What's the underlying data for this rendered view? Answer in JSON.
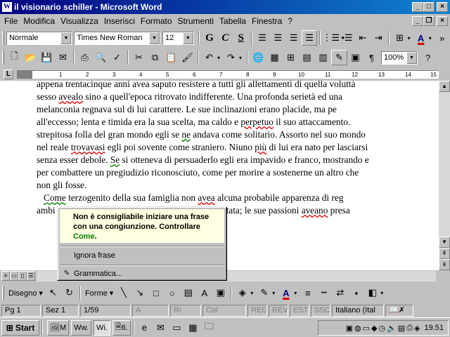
{
  "window": {
    "title": "il visionario schiller - Microsoft Word",
    "app_icon_text": "W",
    "controls": {
      "minimize": "_",
      "maximize": "□",
      "close": "×"
    }
  },
  "menubar": {
    "items": [
      "File",
      "Modifica",
      "Visualizza",
      "Inserisci",
      "Formato",
      "Strumenti",
      "Tabella",
      "Finestra",
      "?"
    ],
    "doc_controls": {
      "minimize": "_",
      "restore": "❐",
      "close": "×"
    }
  },
  "formatting": {
    "style": "Normale",
    "font": "Times New Roman",
    "size": "12",
    "bold": "G",
    "italic": "C",
    "underline": "S",
    "border_dropdown": "▾",
    "font_color_letter": "A"
  },
  "standard": {
    "zoom": "100%"
  },
  "ruler": {
    "tab_selector": "L",
    "ticks": [
      "1",
      "2",
      "3",
      "4",
      "5",
      "6",
      "7",
      "8",
      "9",
      "10",
      "11",
      "12",
      "13",
      "14",
      "15"
    ]
  },
  "document": {
    "lines": [
      {
        "parts": [
          {
            "t": "appena trentacinque anni avea saputo resistere a tutti gli allettamenti di quella voluttà"
          }
        ]
      },
      {
        "parts": [
          {
            "t": "sesso "
          },
          {
            "t": "avealo",
            "sq": "red"
          },
          {
            "t": " sino a quell'epoca ritrovato indifferente. Una profonda serietà ed una"
          }
        ]
      },
      {
        "parts": [
          {
            "t": "melanconia regnava sul di lui carattere. Le sue inclinazioni erano placide, ma pe"
          }
        ]
      },
      {
        "parts": [
          {
            "t": "all'eccesso; lenta e timida era la sua scelta, ma caldo e "
          },
          {
            "t": "perpetuo",
            "sq": "red"
          },
          {
            "t": " il suo attaccamento."
          }
        ]
      },
      {
        "parts": [
          {
            "t": "strepitosa folla del gran mondo egli se "
          },
          {
            "t": "ne",
            "sq": "green"
          },
          {
            "t": " andava come solitario. Assorto nel suo mondo"
          }
        ]
      },
      {
        "parts": [
          {
            "t": "nel reale "
          },
          {
            "t": "trovavasi",
            "sq": "red"
          },
          {
            "t": " egli poi sovente come straniero. Niuno "
          },
          {
            "t": "più",
            "sq": "red"
          },
          {
            "t": " di lui era nato per lasciarsi"
          }
        ]
      },
      {
        "parts": [
          {
            "t": "senza esser debole. "
          },
          {
            "t": "Se",
            "sq": "green"
          },
          {
            "t": " si otteneva di persuaderlo egli era impavido e franco, mostrando e"
          }
        ]
      },
      {
        "parts": [
          {
            "t": "per combattere un pregiudizio riconosciuto, come per morire a sostenerne un altro che"
          }
        ]
      },
      {
        "parts": [
          {
            "t": "non gli fosse."
          }
        ]
      },
      {
        "parts": [
          {
            "t": "   "
          },
          {
            "t": "Come",
            "sq": "green"
          },
          {
            "t": " terzogenito della sua famiglia non "
          },
          {
            "t": "avea",
            "sq": "red"
          },
          {
            "t": " alcuna probabile apparenza di reg"
          }
        ]
      },
      {
        "parts": [
          {
            "t": "ambi"
          },
          {
            "t": "                                                    "
          },
          {
            "t": "orto, manifestata; le sue passioni "
          },
          {
            "t": "aveano",
            "sq": "red"
          },
          {
            "t": " presa"
          }
        ]
      }
    ]
  },
  "context_menu": {
    "message_prefix": "Non è consigliabile iniziare una frase con una congiunzione.  Controllare ",
    "message_word": "Come",
    "message_suffix": ".",
    "ignore": "Ignora frase",
    "grammar": "Grammatica..."
  },
  "drawing": {
    "draw_label": "Disegno",
    "shapes_label": "Forme"
  },
  "status": {
    "page": "Pg  1",
    "section": "Sez  1",
    "pages": "1/59",
    "at": "A",
    "line": "Ri",
    "col": "Col",
    "rec": "REG",
    "rev": "REV",
    "ext": "EST",
    "ovr": "SSC",
    "language": "Italiano (Ital"
  },
  "taskbar": {
    "start": "Start",
    "tasks": [
      {
        "label": "M",
        "active": false
      },
      {
        "label": "w.",
        "active": false
      },
      {
        "label": "i.",
        "active": true
      },
      {
        "label": "6.",
        "active": false
      }
    ],
    "clock": "19.51"
  }
}
